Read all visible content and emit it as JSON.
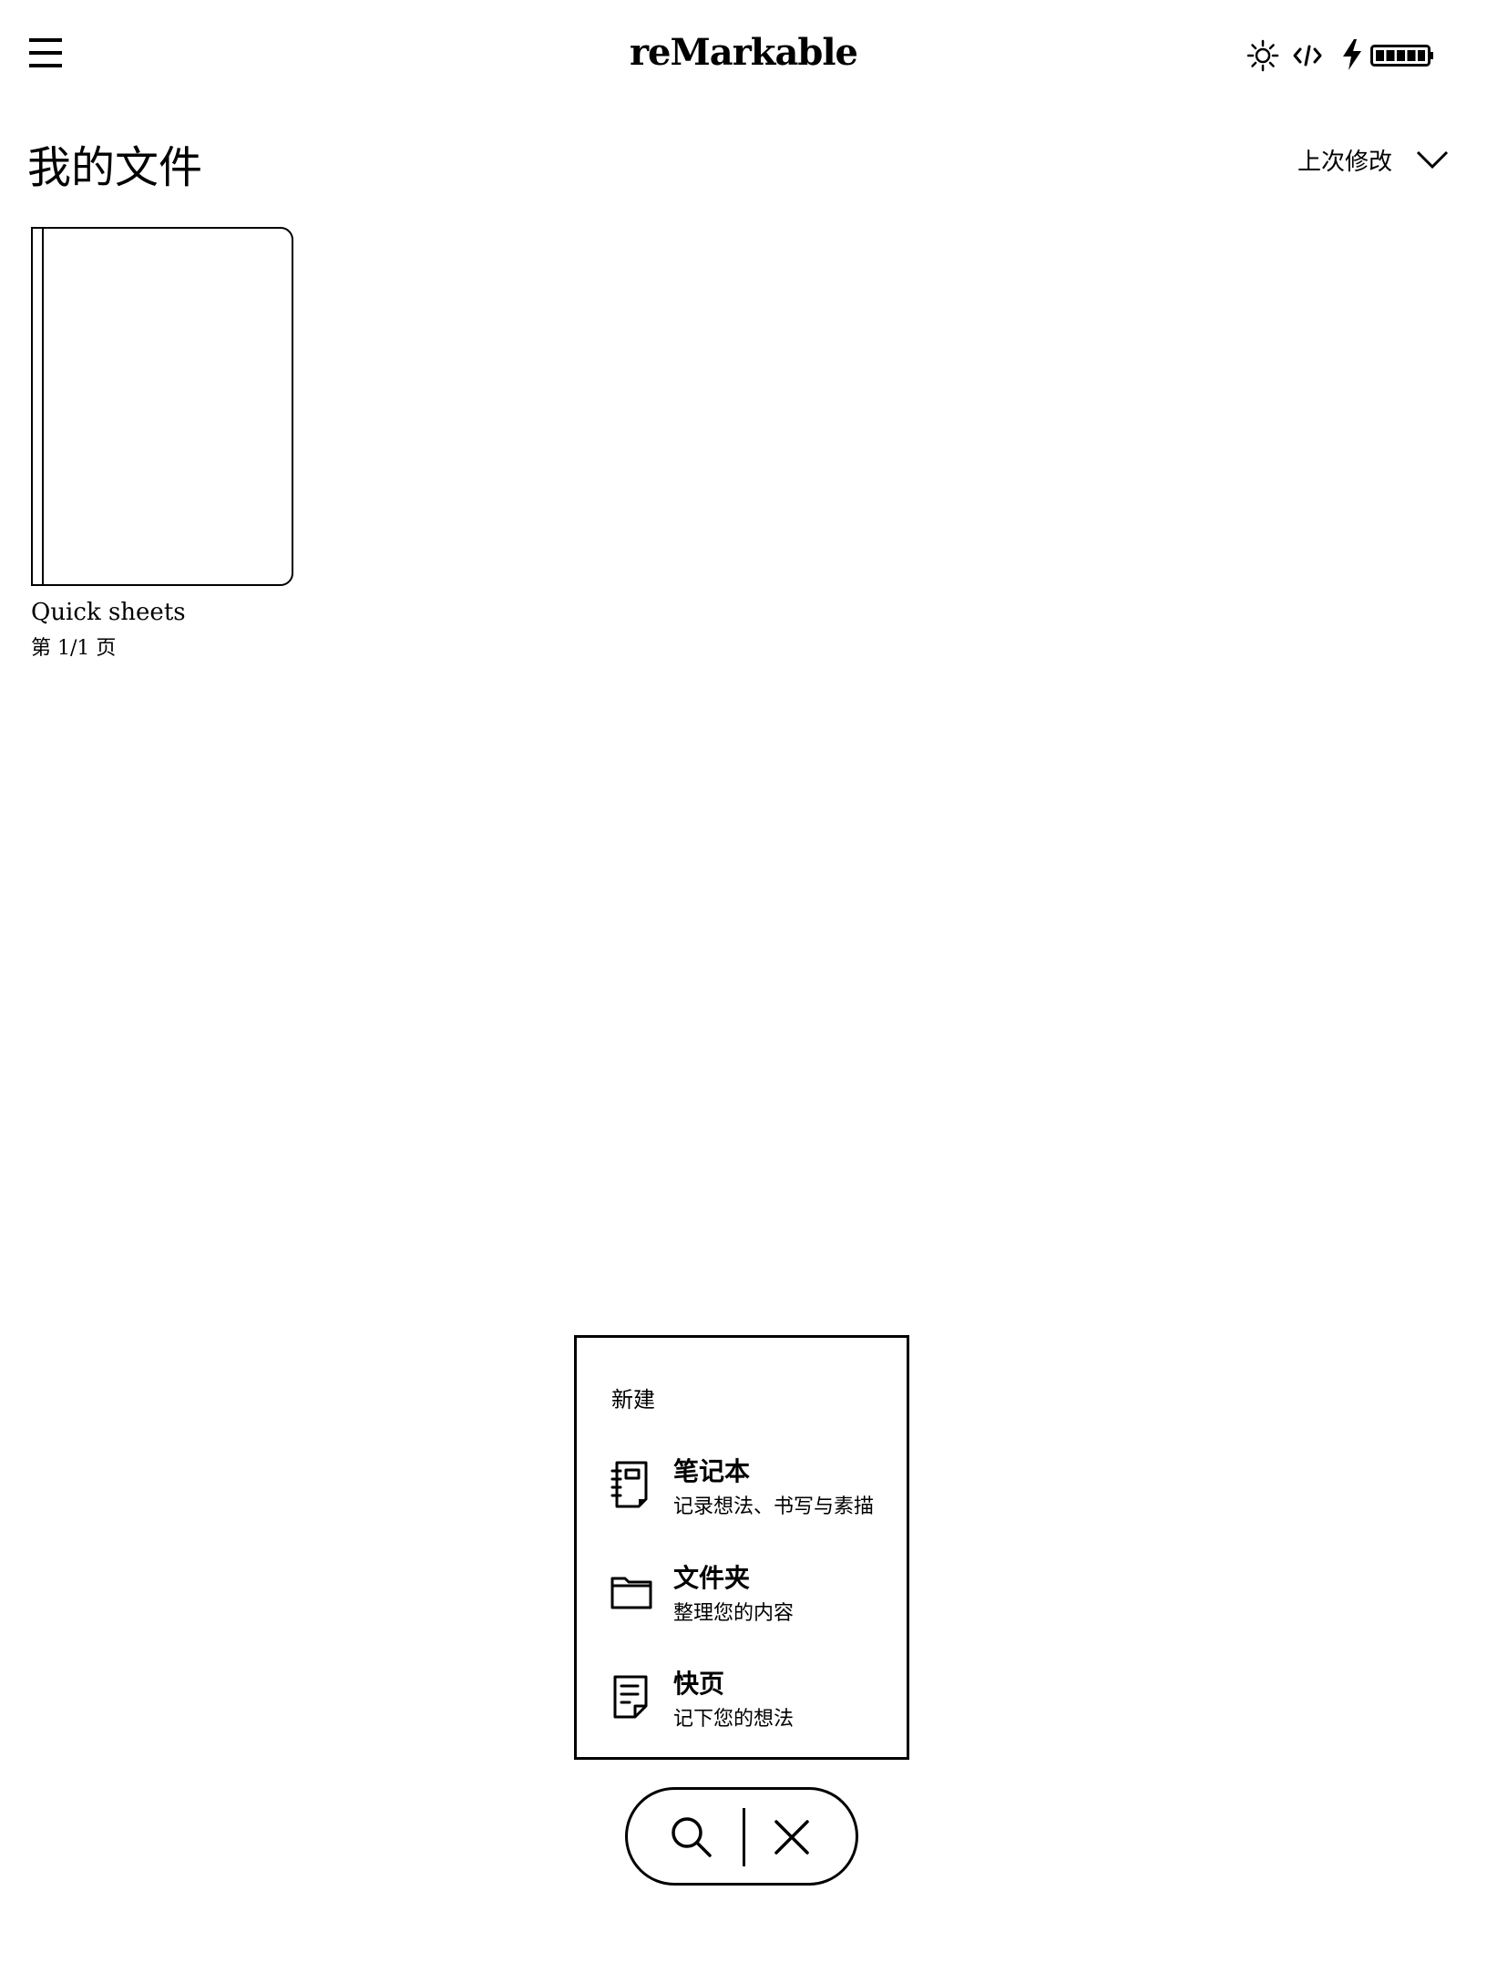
{
  "top_bar": {
    "brand": "reMarkable",
    "status_icons": [
      "brightness-icon",
      "developer-mode-icon",
      "charging-icon",
      "battery-icon"
    ],
    "battery_level": 1.0
  },
  "header": {
    "title": "我的文件",
    "sort_label": "上次修改"
  },
  "documents": [
    {
      "name": "Quick sheets",
      "pages": "第 1/1 页"
    }
  ],
  "new_menu": {
    "title": "新建",
    "items": [
      {
        "icon": "notebook-icon",
        "title": "笔记本",
        "subtitle": "记录想法、书写与素描"
      },
      {
        "icon": "folder-icon",
        "title": "文件夹",
        "subtitle": "整理您的内容"
      },
      {
        "icon": "quick-sheet-icon",
        "title": "快页",
        "subtitle": "记下您的想法"
      }
    ]
  },
  "bottom_bar": {
    "buttons": [
      "search-icon",
      "close-icon"
    ]
  }
}
